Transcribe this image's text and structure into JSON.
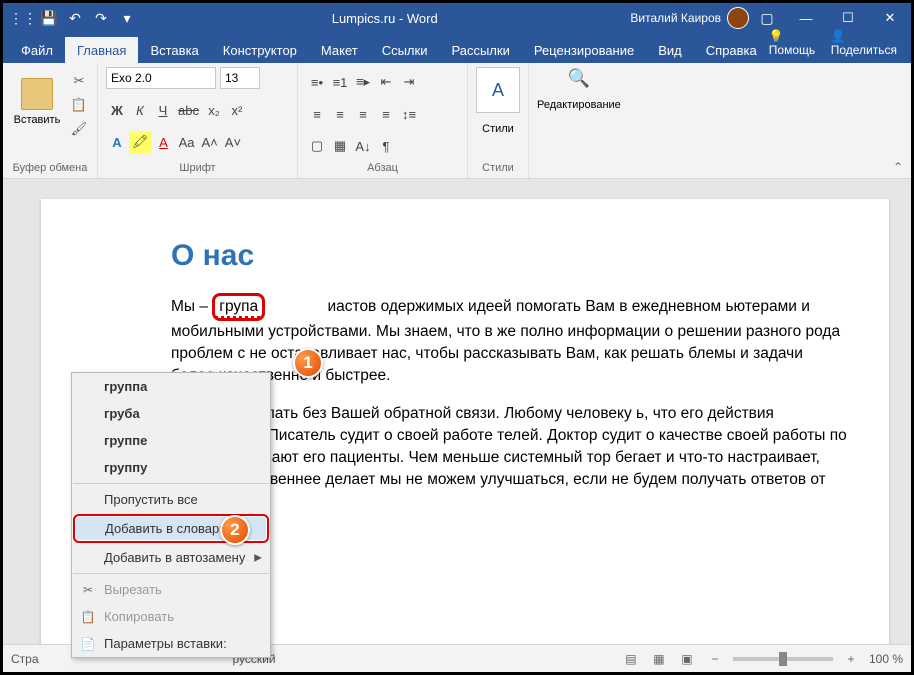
{
  "titlebar": {
    "title": "Lumpics.ru - Word",
    "user": "Виталий Каиров"
  },
  "tabs": {
    "items": [
      "Файл",
      "Главная",
      "Вставка",
      "Конструктор",
      "Макет",
      "Ссылки",
      "Рассылки",
      "Рецензирование",
      "Вид",
      "Справка"
    ],
    "help": "Помощь",
    "share": "Поделиться"
  },
  "ribbon": {
    "clipboard": {
      "paste": "Вставить",
      "label": "Буфер обмена"
    },
    "font": {
      "name": "Exo 2.0",
      "size": "13",
      "label": "Шрифт"
    },
    "paragraph": {
      "label": "Абзац"
    },
    "styles": {
      "btn": "Стили",
      "label": "Стили"
    },
    "editing": {
      "btn": "Редактирование"
    }
  },
  "document": {
    "heading": "О нас",
    "para1_prefix": "Мы – ",
    "misspelled": "група",
    "para1_rest": "иастов одержимых идеей помогать Вам в ежедневном ьютерами и мобильными устройствами. Мы знаем, что в же полно информации о решении разного рода проблем с не останавливает нас, чтобы рассказывать Вам, как решать блемы и задачи более качественно и быстрее.",
    "para2": "ожем это сделать без Вашей обратной связи. Любому человеку ь, что его действия правильные. Писатель судит о своей работе телей. Доктор судит о качестве своей работы по тому, как зливают его пациенты. Чем меньше системный тор бегает и что-то настраивает, тем он качественнее делает  мы не можем улучшаться, если не будем получать ответов от"
  },
  "context_menu": {
    "suggestions": [
      "группа",
      "груба",
      "группе",
      "группу"
    ],
    "skip_all": "Пропустить все",
    "add_dict": "Добавить в словарь",
    "add_autocorrect": "Добавить в автозамену",
    "cut": "Вырезать",
    "copy": "Копировать",
    "paste_opts": "Параметры вставки:"
  },
  "statusbar": {
    "page": "Стра",
    "lang": "русский",
    "zoom": "100 %"
  },
  "badges": {
    "one": "1",
    "two": "2"
  }
}
